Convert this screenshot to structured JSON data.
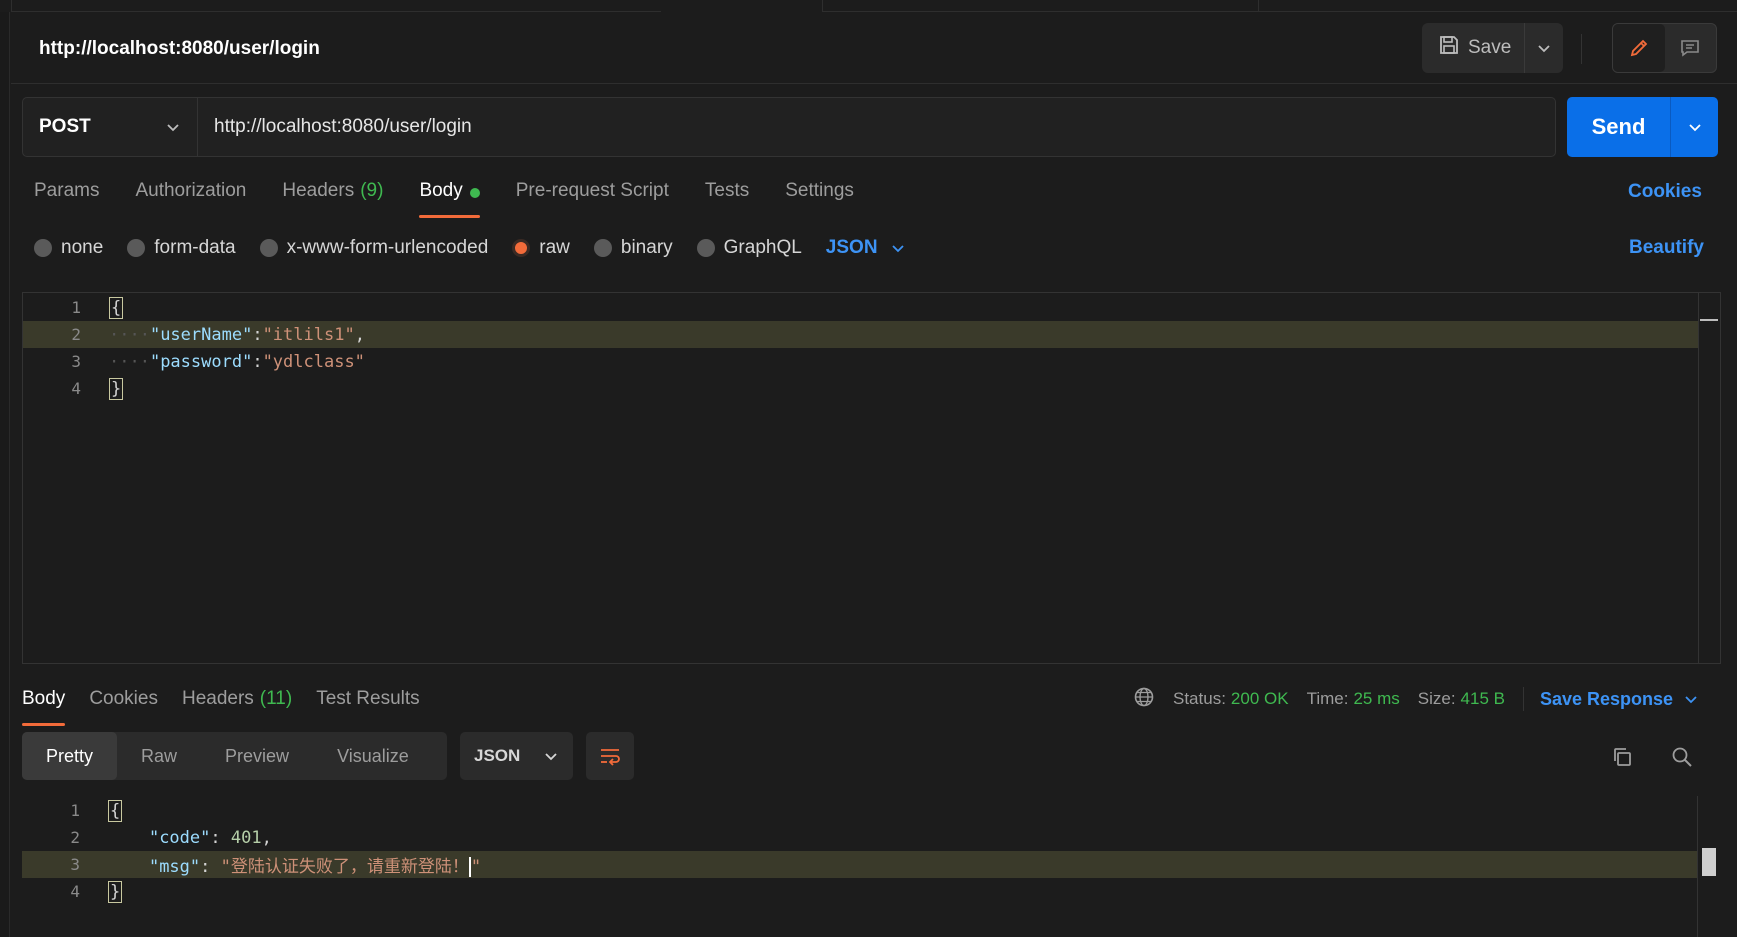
{
  "header": {
    "title": "http://localhost:8080/user/login",
    "save_label": "Save"
  },
  "request": {
    "method": "POST",
    "url": "http://localhost:8080/user/login",
    "send_label": "Send"
  },
  "request_tabs": [
    {
      "label": "Params"
    },
    {
      "label": "Authorization"
    },
    {
      "label": "Headers",
      "count": "(9)"
    },
    {
      "label": "Body"
    },
    {
      "label": "Pre-request Script"
    },
    {
      "label": "Tests"
    },
    {
      "label": "Settings"
    }
  ],
  "cookies_link": "Cookies",
  "body_types": [
    "none",
    "form-data",
    "x-www-form-urlencoded",
    "raw",
    "binary",
    "GraphQL"
  ],
  "body_language": "JSON",
  "beautify_link": "Beautify",
  "request_body": {
    "line_numbers": [
      "1",
      "2",
      "3",
      "4"
    ],
    "open_brace": "{",
    "close_brace": "}",
    "key1": "\"userName\"",
    "val1": "\"itlils1\"",
    "key2": "\"password\"",
    "val2": "\"ydlclass\"",
    "indent": "····"
  },
  "response_tabs": [
    {
      "label": "Body"
    },
    {
      "label": "Cookies"
    },
    {
      "label": "Headers",
      "count": "(11)"
    },
    {
      "label": "Test Results"
    }
  ],
  "status": {
    "status_label": "Status:",
    "status_value": "200 OK",
    "time_label": "Time:",
    "time_value": "25 ms",
    "size_label": "Size:",
    "size_value": "415 B",
    "save_response": "Save Response"
  },
  "response_views": [
    "Pretty",
    "Raw",
    "Preview",
    "Visualize"
  ],
  "response_format": "JSON",
  "response_body": {
    "line_numbers": [
      "1",
      "2",
      "3",
      "4"
    ],
    "open_brace": "{",
    "close_brace": "}",
    "key1": "\"code\"",
    "val1": "401",
    "key2": "\"msg\"",
    "val2": "\"登陆认证失败了，请重新登陆！",
    "val2_end": "\""
  },
  "colors": {
    "accent_orange": "#f26b3a",
    "send_blue": "#0a6fe8",
    "link_blue": "#3d93f5",
    "success_green": "#3fb950"
  }
}
